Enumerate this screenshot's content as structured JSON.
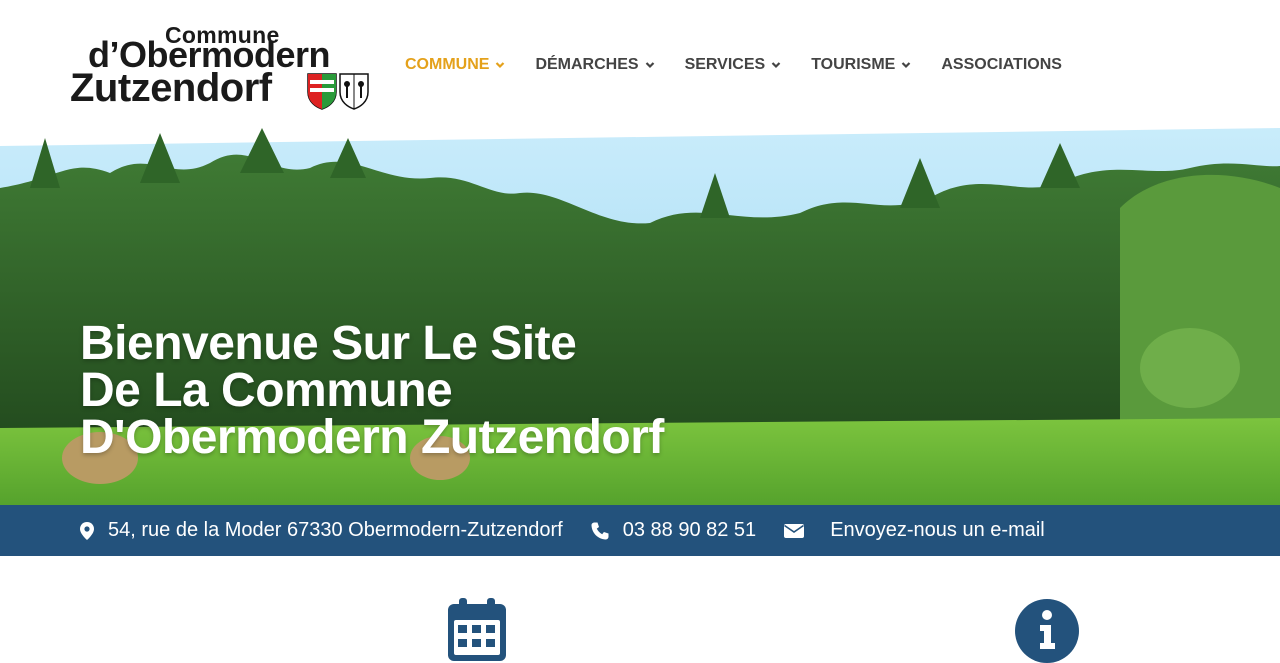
{
  "logo": {
    "line1": "Commune",
    "line2": "d’Obermodern",
    "line3": "Zutzendorf"
  },
  "nav": {
    "items": [
      {
        "label": "COMMUNE",
        "has_dropdown": true,
        "active": true
      },
      {
        "label": "DÉMARCHES",
        "has_dropdown": true,
        "active": false
      },
      {
        "label": "SERVICES",
        "has_dropdown": true,
        "active": false
      },
      {
        "label": "TOURISME",
        "has_dropdown": true,
        "active": false
      },
      {
        "label": "ASSOCIATIONS",
        "has_dropdown": false,
        "active": false
      }
    ]
  },
  "hero": {
    "title_lines": [
      "Bienvenue Sur Le Site",
      "De La Commune",
      "D'Obermodern Zutzendorf"
    ]
  },
  "infobar": {
    "address": "54, rue de la Moder 67330 Obermodern-Zutzendorf",
    "phone": "03 88 90 82 51",
    "email_link": "Envoyez-nous un e-mail",
    "icons": [
      "map-marker-icon",
      "phone-icon",
      "envelope-icon"
    ]
  },
  "bottom": {
    "icons": [
      "calendar-icon",
      "info-circle-icon"
    ]
  },
  "colors": {
    "accent": "#e4a11b",
    "nav_text": "#444444",
    "infobar": "#23527c",
    "icon_blue": "#23527c"
  }
}
